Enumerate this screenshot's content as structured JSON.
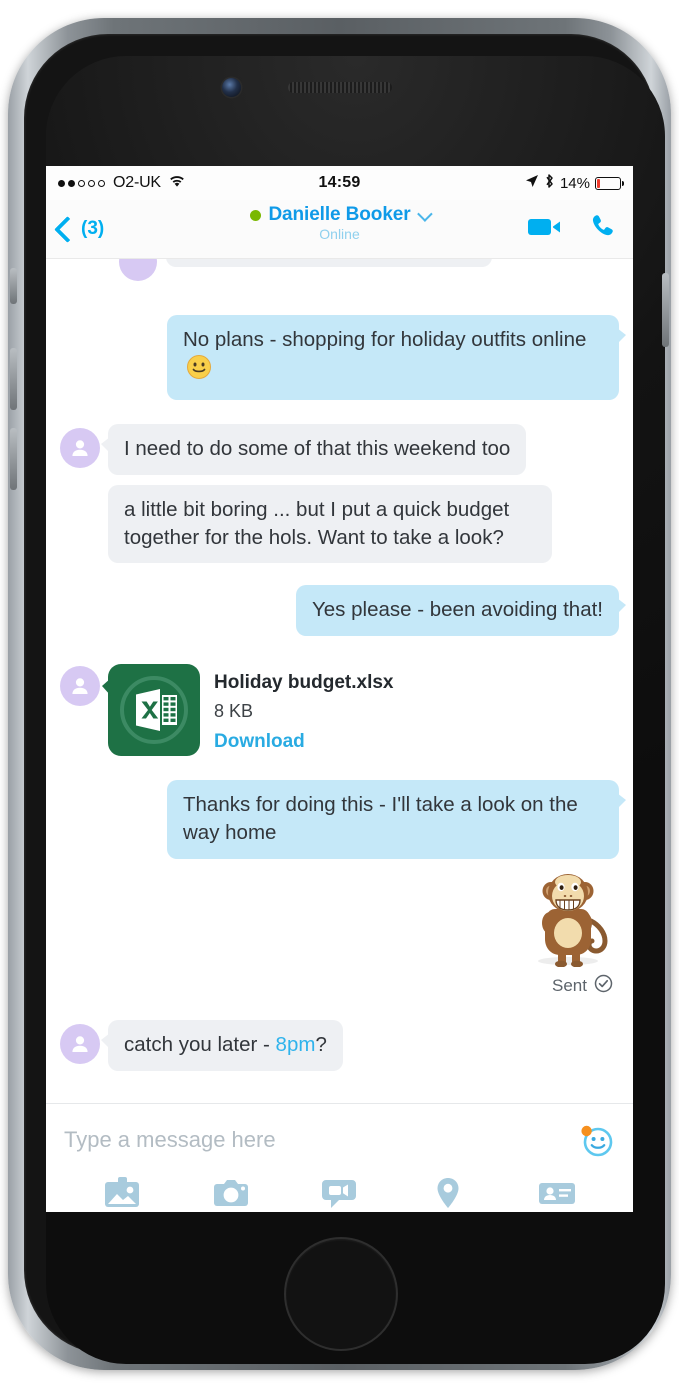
{
  "status_bar": {
    "signal_dots_filled": 2,
    "signal_dots_total": 5,
    "carrier": "O2-UK",
    "wifi_icon": "wifi-icon",
    "time": "14:59",
    "location_icon": "location-arrow-icon",
    "bluetooth_icon": "bluetooth-icon",
    "battery_percent": "14%"
  },
  "nav_bar": {
    "back_label": "(3)",
    "back_icon": "chevron-left-icon",
    "presence_status": "online",
    "contact_name": "Danielle Booker",
    "dropdown_icon": "chevron-down-icon",
    "subtitle": "Online",
    "video_call_icon": "video-camera-icon",
    "voice_call_icon": "phone-handset-icon"
  },
  "colors": {
    "skype_blue": "#00AFF0",
    "outgoing_bubble": "#c5e8f8",
    "incoming_bubble": "#eef0f3",
    "presence_green": "#7AB800",
    "avatar_purple": "#d7c9f3",
    "excel_green": "#1e7145",
    "link_blue": "#29ABE2",
    "battery_red": "#ef3b2d"
  },
  "messages": [
    {
      "id": "m0",
      "direction": "incoming",
      "type": "cut-off",
      "text": ""
    },
    {
      "id": "m1",
      "direction": "outgoing",
      "type": "text",
      "text": "No plans - shopping for holiday outfits online",
      "emoji": "smiley-emoticon"
    },
    {
      "id": "m2",
      "direction": "incoming",
      "type": "text",
      "text": "I need to do some of that this weekend too",
      "has_avatar": true
    },
    {
      "id": "m3",
      "direction": "incoming",
      "type": "text",
      "text": "a little bit boring ... but I put a quick budget together for the hols. Want to take a look?",
      "has_avatar": false
    },
    {
      "id": "m4",
      "direction": "outgoing",
      "type": "text",
      "text": "Yes please - been avoiding that!"
    },
    {
      "id": "m5",
      "direction": "incoming",
      "type": "file",
      "file_icon": "excel-file-icon",
      "file_name": "Holiday budget.xlsx",
      "file_size": "8 KB",
      "download_label": "Download"
    },
    {
      "id": "m6",
      "direction": "outgoing",
      "type": "text",
      "text": "Thanks for doing this - I'll take a look on the way home"
    },
    {
      "id": "m7",
      "direction": "outgoing",
      "type": "sticker",
      "sticker_name": "monkey-emoticon",
      "status_label": "Sent",
      "status_icon": "check-circle-icon"
    },
    {
      "id": "m8",
      "direction": "incoming",
      "type": "text-with-link",
      "text_before": "catch you later - ",
      "link_text": "8pm",
      "text_after": "?",
      "has_avatar": true
    }
  ],
  "composer": {
    "placeholder": "Type a message here",
    "emoji_button_icon": "smiley-face-icon",
    "tools": [
      {
        "name": "gallery-icon",
        "label": "Photo"
      },
      {
        "name": "camera-icon",
        "label": "Camera"
      },
      {
        "name": "video-message-icon",
        "label": "Video message"
      },
      {
        "name": "location-pin-icon",
        "label": "Location"
      },
      {
        "name": "contact-card-icon",
        "label": "Contact"
      }
    ]
  }
}
